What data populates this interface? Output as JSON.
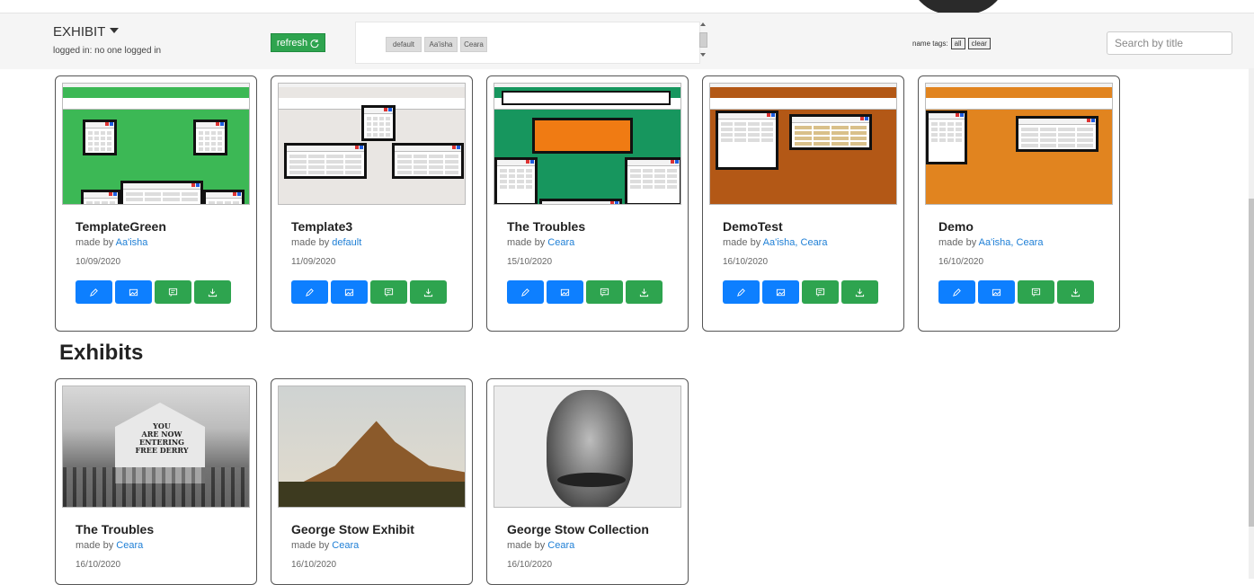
{
  "header": {
    "app_title": "EXHIBIT",
    "login_status": "logged in: no one logged in",
    "refresh_label": "refresh",
    "tags": [
      "default",
      "Aa'isha",
      "Ceara"
    ],
    "name_tags_label": "name tags:",
    "all_label": "all",
    "clear_label": "clear",
    "search_placeholder": "Search by title"
  },
  "templates": [
    {
      "title": "TemplateGreen",
      "made_by": "made by",
      "authors": "Aa'isha",
      "date": "10/09/2020",
      "bg": "#3cb855"
    },
    {
      "title": "Template3",
      "made_by": "made by",
      "authors": "default",
      "date": "11/09/2020",
      "bg": "#e9e6e3"
    },
    {
      "title": "The Troubles",
      "made_by": "made by",
      "authors": "Ceara",
      "date": "15/10/2020",
      "bg": "#17965e"
    },
    {
      "title": "DemoTest",
      "made_by": "made by",
      "authors": "Aa'isha, Ceara",
      "date": "16/10/2020",
      "bg": "#b35816"
    },
    {
      "title": "Demo",
      "made_by": "made by",
      "authors": "Aa'isha, Ceara",
      "date": "16/10/2020",
      "bg": "#e1841f"
    }
  ],
  "exhibits_heading": "Exhibits",
  "exhibits": [
    {
      "title": "The Troubles",
      "made_by": "made by",
      "authors": "Ceara",
      "date": "16/10/2020",
      "image": "black-and-white-street-photo"
    },
    {
      "title": "George Stow Exhibit",
      "made_by": "made by",
      "authors": "Ceara",
      "date": "16/10/2020",
      "image": "mountain-landscape-photo"
    },
    {
      "title": "George Stow Collection",
      "made_by": "made by",
      "authors": "Ceara",
      "date": "16/10/2020",
      "image": "engraved-portrait"
    }
  ],
  "colors": {
    "primary": "#0d7fff",
    "success": "#2ea44f",
    "link": "#1e7fd6"
  },
  "icons": {
    "edit": "pencil-icon",
    "image": "image-icon",
    "comment": "comment-icon",
    "download": "download-icon",
    "refresh": "refresh-icon"
  }
}
